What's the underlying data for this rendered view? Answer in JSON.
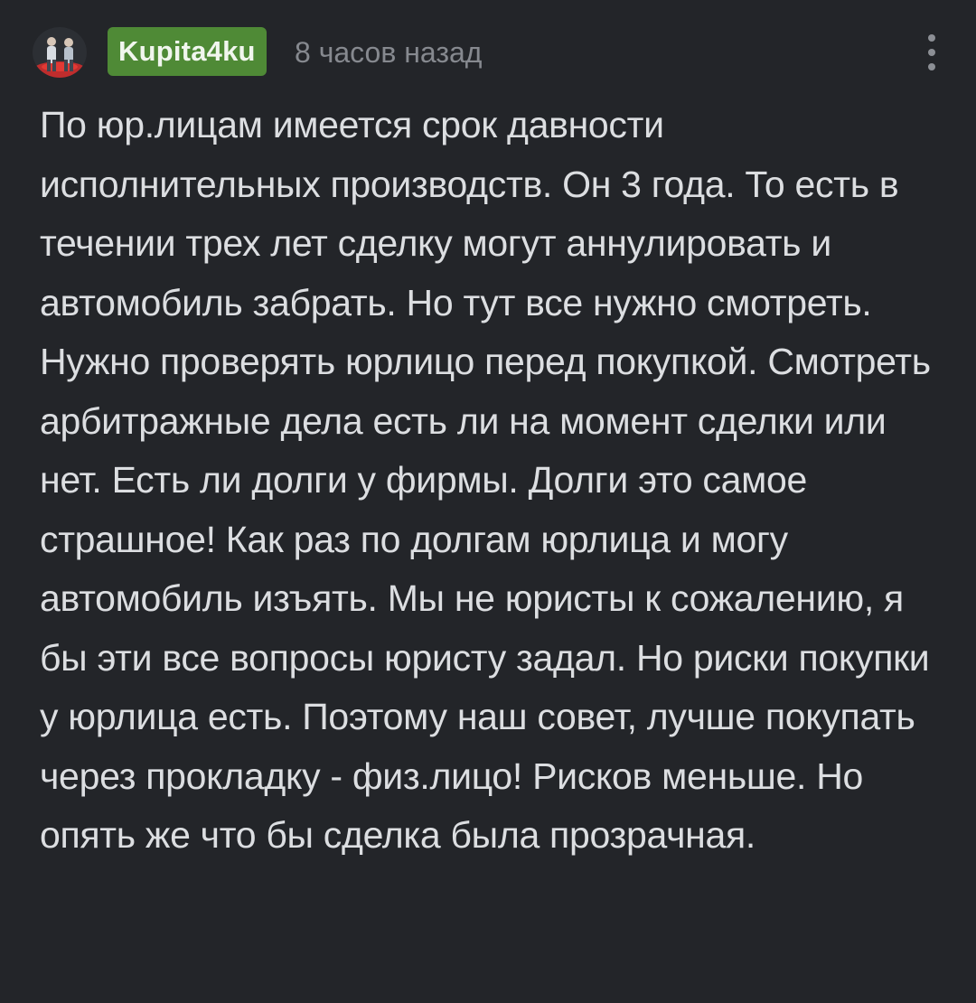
{
  "comment": {
    "author": "Kupita4ku",
    "timestamp": "8 часов назад",
    "body": "По юр.лицам имеется срок давности исполнительных производств. Он 3 года. То есть в течении трех лет сделку могут аннулировать и автомобиль забрать. Но тут все нужно смотреть. Нужно проверять юрлицо перед покупкой. Смотреть арбитражные дела есть ли на момент сделки или нет. Есть ли долги у фирмы. Долги это самое страшное! Как раз по долгам юрлица и могу автомобиль изъять. Мы не юристы к сожалению, я бы эти все вопросы юристу задал. Но риски покупки у юрлица есть. Поэтому наш совет, лучше покупать через прокладку - физ.лицо! Рисков меньше. Но опять же что бы сделка была прозрачная."
  },
  "icons": {
    "avatar": "avatar-photo-icon",
    "more": "more-vertical-icon"
  },
  "colors": {
    "background": "#232529",
    "author_badge": "#4f8a36",
    "text": "#dcdee1",
    "muted": "#86898f"
  }
}
